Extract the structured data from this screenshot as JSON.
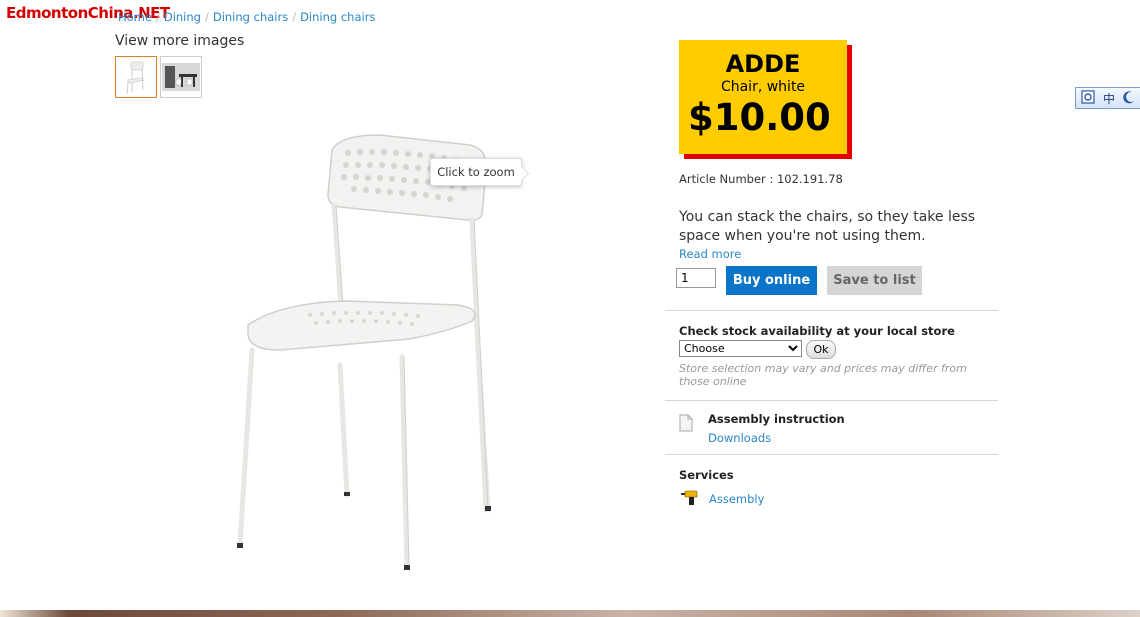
{
  "watermark": {
    "text": "EdmontonChina.NET"
  },
  "breadcrumb": {
    "items": [
      {
        "label": "Home"
      },
      {
        "label": "Dining"
      },
      {
        "label": "Dining chairs"
      },
      {
        "label": "Dining chairs"
      }
    ],
    "separator": "/"
  },
  "gallery": {
    "view_more_label": "View more images",
    "zoom_tooltip": "Click to zoom"
  },
  "product": {
    "name": "ADDE",
    "description": "Chair, white",
    "price": "$10.00",
    "article_number_label": "Article Number :",
    "article_number": "102.191.78",
    "summary": "You can stack the chairs, so they take less space when you're not using them.",
    "read_more_label": "Read more"
  },
  "purchase": {
    "quantity": "1",
    "buy_label": "Buy online",
    "save_label": "Save to list"
  },
  "stock": {
    "title": "Check stock availability at your local store",
    "store_selected": "Choose",
    "ok_label": "Ok",
    "note": "Store selection may vary and prices may differ from those online"
  },
  "assembly": {
    "title": "Assembly instruction",
    "downloads_label": "Downloads"
  },
  "services": {
    "title": "Services",
    "assembly_label": "Assembly"
  },
  "ime_toolbar": {
    "mode_label": "中"
  },
  "colors": {
    "price_box": "#ffcc00",
    "price_shadow": "#e50000",
    "link": "#2a86c8",
    "buy_button": "#0a74c8"
  }
}
